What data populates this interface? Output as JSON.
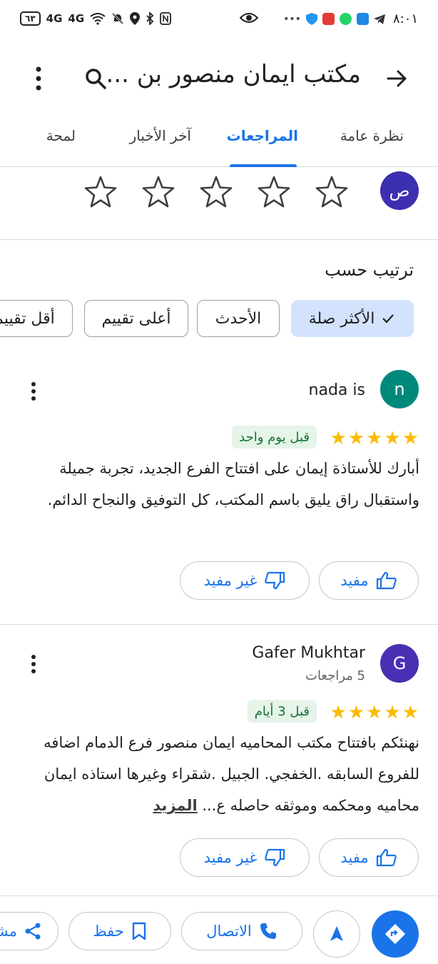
{
  "status_bar": {
    "battery": "٦٣",
    "signal_1": "4G",
    "signal_2": "4G",
    "time": "٨:٠١"
  },
  "header": {
    "title": "مكتب ايمان منصور بن ...",
    "back_icon": "arrow-back-icon",
    "search_icon": "search-icon",
    "more_icon": "more-vert-icon"
  },
  "tabs": [
    {
      "label": "نظرة عامة",
      "active": false
    },
    {
      "label": "المراجعات",
      "active": true
    },
    {
      "label": "آخر الأخبار",
      "active": false
    },
    {
      "label": "لمحة",
      "active": false
    }
  ],
  "rate": {
    "avatar_letter": "ص",
    "avatar_color": "#3c2fb0",
    "stars_count": 5
  },
  "sort": {
    "label": "ترتيب حسب",
    "chips": [
      {
        "label": "الأكثر صلة",
        "selected": true
      },
      {
        "label": "الأحدث",
        "selected": false
      },
      {
        "label": "أعلى تقييم",
        "selected": false
      },
      {
        "label": "أقل تقييم",
        "selected": false
      }
    ]
  },
  "reviews": [
    {
      "name": "nada is",
      "subtitle": "",
      "avatar_letter": "n",
      "avatar_color": "#00897b",
      "rating": 5,
      "date": "قبل يوم واحد",
      "text": "أبارك للأستاذة إيمان على افتتاح الفرع الجديد، تجربة جميلة واستقبال راق يليق باسم المكتب، كل التوفيق والنجاح الدائم.",
      "more_label": "",
      "helpful_label": "مفيد",
      "not_helpful_label": "غير مفيد"
    },
    {
      "name": "Gafer Mukhtar",
      "subtitle": "5 مراجعات",
      "avatar_letter": "G",
      "avatar_color": "#4a2fb4",
      "rating": 5,
      "date": "قبل 3 أيام",
      "text": "نهنئكم بافتتاح مكتب المحاميه ايمان منصور فرع الدمام اضافه للفروع السابقه .الخفجي. الجبيل .شقراء وغيرها استاذه ايمان محاميه ومحكمه وموثقه حاصله ع...",
      "more_label": "المزيد",
      "helpful_label": "مفيد",
      "not_helpful_label": "غير مفيد"
    }
  ],
  "bottom_bar": {
    "directions_icon": "directions-icon",
    "navigate_icon": "navigation-arrow-icon",
    "call_label": "الاتصال",
    "save_label": "حفظ",
    "share_label": "مشاركة",
    "accent_color": "#1a73e8"
  }
}
